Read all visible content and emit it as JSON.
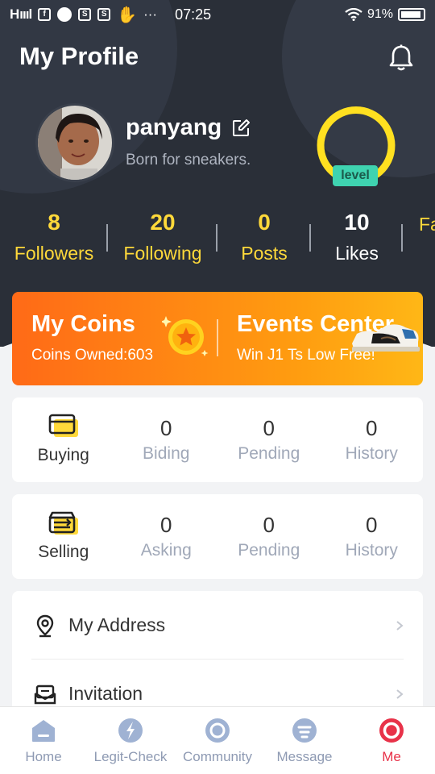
{
  "status_bar": {
    "signal": "H",
    "time": "07:25",
    "more": "···",
    "battery": "91%",
    "battery_fraction": 0.91
  },
  "header": {
    "title": "My Profile"
  },
  "profile": {
    "username": "panyang",
    "bio": "Born for sneakers.",
    "level_label": "level"
  },
  "stats": [
    {
      "value": "8",
      "label": "Followers"
    },
    {
      "value": "20",
      "label": "Following"
    },
    {
      "value": "0",
      "label": "Posts"
    },
    {
      "value": "10",
      "label": "Likes"
    },
    {
      "value": "",
      "label": "Fa"
    }
  ],
  "coins": {
    "title": "My Coins",
    "subtitle": "Coins Owned:603",
    "events_title": "Events Center",
    "events_subtitle": "Win J1 Ts Low Free!"
  },
  "buying": {
    "label": "Buying",
    "cells": [
      {
        "value": "0",
        "label": "Biding"
      },
      {
        "value": "0",
        "label": "Pending"
      },
      {
        "value": "0",
        "label": "History"
      }
    ]
  },
  "selling": {
    "label": "Selling",
    "cells": [
      {
        "value": "0",
        "label": "Asking"
      },
      {
        "value": "0",
        "label": "Pending"
      },
      {
        "value": "0",
        "label": "History"
      }
    ]
  },
  "menu": [
    {
      "label": "My Address",
      "icon": "location-pin-icon"
    },
    {
      "label": "Invitation",
      "icon": "invitation-icon"
    }
  ],
  "nav": [
    {
      "label": "Home",
      "icon": "home-icon"
    },
    {
      "label": "Legit-Check",
      "icon": "legit-check-icon"
    },
    {
      "label": "Community",
      "icon": "community-icon"
    },
    {
      "label": "Message",
      "icon": "message-icon"
    },
    {
      "label": "Me",
      "icon": "me-icon",
      "active": true
    }
  ],
  "colors": {
    "accent_yellow": "#ffd93a",
    "active_red": "#e83249",
    "header_dark": "#2a2f38",
    "level_green": "#3fd3b0"
  }
}
